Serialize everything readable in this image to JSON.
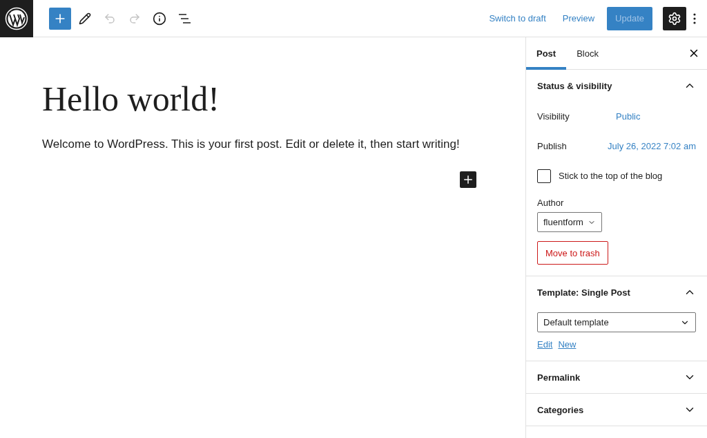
{
  "toolbar": {
    "tools": [
      {
        "kind": "add",
        "disabled": false
      },
      {
        "kind": "edit",
        "disabled": false
      },
      {
        "kind": "undo",
        "disabled": true
      },
      {
        "kind": "redo",
        "disabled": true
      },
      {
        "kind": "info",
        "disabled": false
      },
      {
        "kind": "outline",
        "disabled": false
      }
    ],
    "links": [
      "Switch to draft",
      "Preview"
    ],
    "update": {
      "label": "Update",
      "disabled": true
    },
    "settings": {
      "selected": true
    }
  },
  "editor": {
    "title": "Hello world!",
    "paragraph": "Welcome to WordPress. This is your first post. Edit or delete it, then start writing!"
  },
  "sidebar": {
    "tabs": [
      {
        "label": "Post",
        "selected": true
      },
      {
        "label": "Block",
        "selected": false
      }
    ],
    "panels": [
      {
        "kind": "status",
        "title": "Status & visibility",
        "expanded": true,
        "rows": [
          {
            "label": "Visibility",
            "value": "Public"
          },
          {
            "label": "Publish",
            "value": "July 26, 2022 7:02 am"
          }
        ],
        "sticky": {
          "label": "Stick to the top of the blog",
          "checked": false
        },
        "author_label": "Author",
        "author": "fluentform",
        "trash": "Move to trash"
      },
      {
        "kind": "template",
        "title": "Template: Single Post",
        "expanded": true,
        "select": "Default template",
        "links": [
          "Edit",
          "New"
        ]
      },
      {
        "title": "Permalink",
        "expanded": false
      },
      {
        "title": "Categories",
        "expanded": false
      }
    ]
  }
}
